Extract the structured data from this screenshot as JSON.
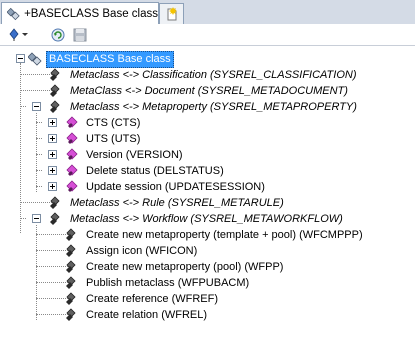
{
  "tabs": {
    "active_label": "+BASECLASS Base class",
    "new_tab_icon": "new-tab-icon"
  },
  "toolbar": {
    "items": [
      "pin-icon",
      "dropdown-arrow-icon",
      "refresh-icon",
      "save-icon"
    ]
  },
  "tree": {
    "root": "BASECLASS Base class",
    "items": [
      "Metaclass <-> Classification (SYSREL_CLASSIFICATION)",
      "MetaClass <-> Document (SYSREL_METADOCUMENT)",
      "Metaclass <-> Metaproperty (SYSREL_METAPROPERTY)",
      "CTS (CTS)",
      "UTS (UTS)",
      "Version (VERSION)",
      "Delete status (DELSTATUS)",
      "Update session (UPDATESESSION)",
      "Metaclass  <-> Rule (SYSREL_METARULE)",
      "Metaclass <-> Workflow (SYSREL_METAWORKFLOW)",
      "Create new metaproperty (template + pool) (WFCMPPP)",
      "Assign icon (WFICON)",
      "Create new metaproperty (pool) (WFPP)",
      "Publish metaclass (WFPUBACM)",
      "Create reference (WFREF)",
      "Create relation (WFREL)"
    ]
  },
  "colors": {
    "selection": "#3399ff",
    "chrome": "#d4dbe6",
    "metaproperty_icon": "#c040c0"
  }
}
